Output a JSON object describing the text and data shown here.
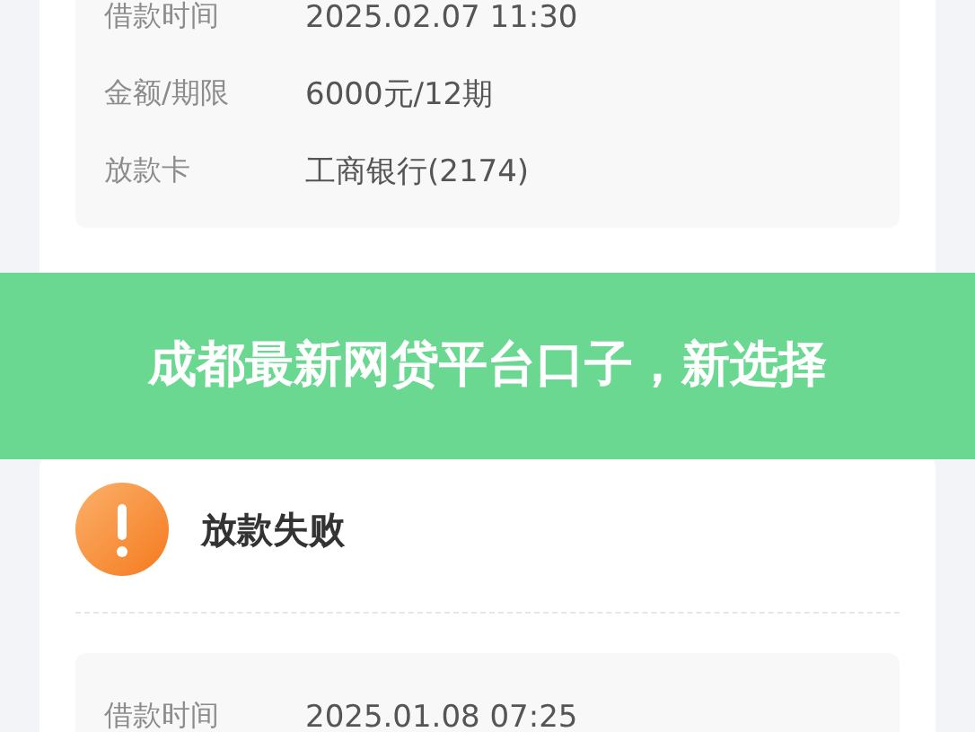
{
  "banner": {
    "title": "成都最新网贷平台口子，新选择"
  },
  "orders": [
    {
      "fields": [
        {
          "label": "借款时间",
          "value": "2025.02.07 11:30"
        },
        {
          "label": "金额/期限",
          "value": "6000元/12期"
        },
        {
          "label": "放款卡",
          "value": "工商银行(2174)"
        }
      ]
    },
    {
      "status": "放款失败",
      "fields": [
        {
          "label": "借款时间",
          "value": "2025.01.08 07:25"
        }
      ]
    }
  ]
}
